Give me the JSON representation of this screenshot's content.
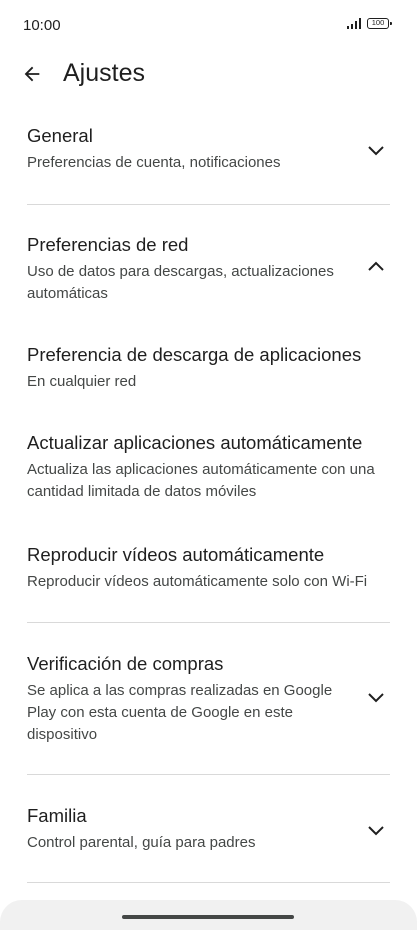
{
  "status_bar": {
    "time": "10:00",
    "battery": "100"
  },
  "header": {
    "title": "Ajustes",
    "back_icon": "arrow-left-icon"
  },
  "sections": [
    {
      "title": "General",
      "subtitle": "Preferencias de cuenta, notificaciones",
      "expanded": false
    },
    {
      "title": "Preferencias de red",
      "subtitle": "Uso de datos para descargas, actualizaciones automáticas",
      "expanded": true
    },
    {
      "title": "Verificación de compras",
      "subtitle": "Se aplica a las compras realizadas en Google Play con esta cuenta de Google en este dispositivo",
      "expanded": false
    },
    {
      "title": "Familia",
      "subtitle": "Control parental, guía para padres",
      "expanded": false
    }
  ],
  "network_items": [
    {
      "title": "Preferencia de descarga de aplicaciones",
      "subtitle": "En cualquier red"
    },
    {
      "title": "Actualizar aplicaciones automáticamente",
      "subtitle": "Actualiza las aplicaciones automáticamente con una cantidad limitada de datos móviles"
    },
    {
      "title": "Reproducir vídeos automáticamente",
      "subtitle": "Reproducir vídeos automáticamente solo con Wi-Fi"
    }
  ]
}
